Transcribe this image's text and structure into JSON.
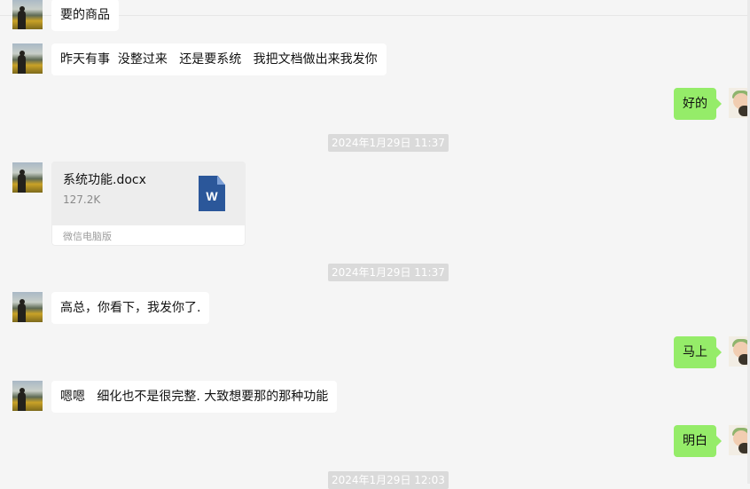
{
  "messages": {
    "m0": "要的商品",
    "m1": "昨天有事  没整过来   还是要系统   我把文档做出来我发你",
    "m2": "好的",
    "ts1": "2024年1月29日 11:37",
    "file": {
      "name": "系统功能.docx",
      "size": "127.2K",
      "source": "微信电脑版",
      "icon": "word-doc-icon",
      "icon_letter": "W"
    },
    "ts2": "2024年1月29日 11:37",
    "m3": "高总，你看下，我发你了.",
    "m4": "马上",
    "m5": "嗯嗯   细化也不是很完整. 大致想要那的那种功能",
    "m6": "明白",
    "ts3": "2024年1月29日 12:03"
  },
  "colors": {
    "background": "#f5f5f5",
    "bubble_self": "#95ec69",
    "bubble_other": "#ffffff",
    "timestamp_bg": "#dadada",
    "word_blue": "#2b579a"
  }
}
